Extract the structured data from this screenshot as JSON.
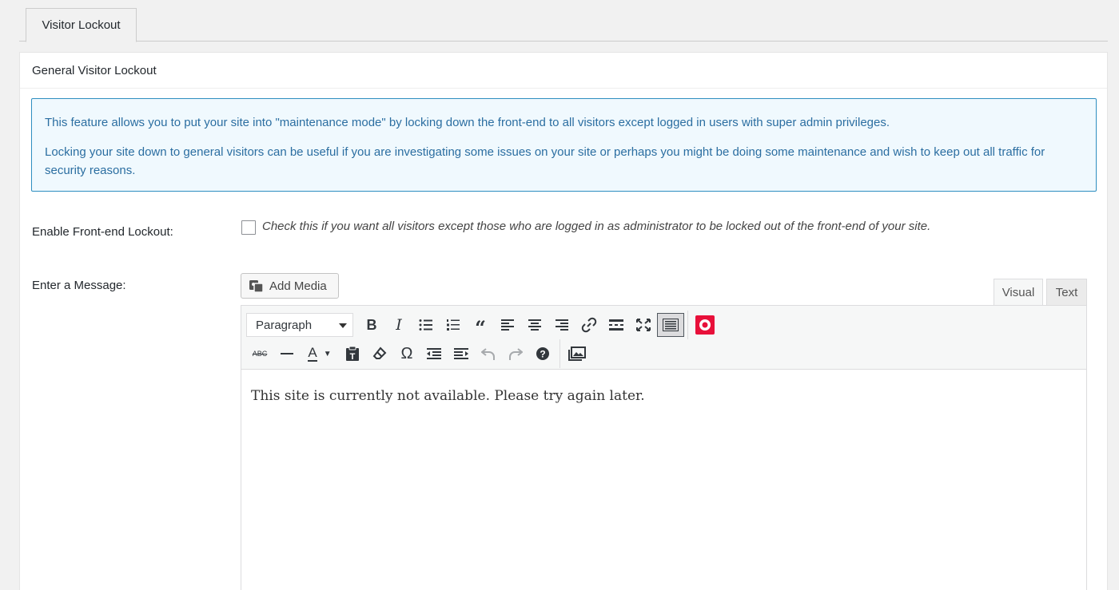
{
  "tabs": {
    "active_label": "Visitor Lockout"
  },
  "panel": {
    "title": "General Visitor Lockout",
    "notice": [
      "This feature allows you to put your site into \"maintenance mode\" by locking down the front-end to all visitors except logged in users with super admin privileges.",
      "Locking your site down to general visitors can be useful if you are investigating some issues on your site or perhaps you might be doing some maintenance and wish to keep out all traffic for security reasons."
    ]
  },
  "lockout": {
    "label": "Enable Front-end Lockout:",
    "checked": false,
    "description": "Check this if you want all visitors except those who are logged in as administrator to be locked out of the front-end of your site."
  },
  "message": {
    "label": "Enter a Message:",
    "add_media_label": "Add Media",
    "editor_tabs": {
      "visual": "Visual",
      "text": "Text"
    },
    "format_select": "Paragraph",
    "content": "This site is currently not available. Please try again later."
  },
  "toolbar": {
    "row1_icons": [
      "bold-icon",
      "italic-icon",
      "bullet-list-icon",
      "numbered-list-icon",
      "blockquote-icon",
      "align-left-icon",
      "align-center-icon",
      "align-right-icon",
      "link-icon",
      "read-more-icon",
      "fullscreen-icon",
      "toolbar-toggle-icon",
      "plugin-record-icon"
    ],
    "row2_icons": [
      "strikethrough-icon",
      "horizontal-line-icon",
      "text-color-icon",
      "paste-text-icon",
      "clear-formatting-icon",
      "special-character-icon",
      "outdent-icon",
      "indent-icon",
      "undo-icon",
      "redo-icon",
      "help-icon",
      "gallery-icon"
    ],
    "accent_color": "#e8103a"
  }
}
